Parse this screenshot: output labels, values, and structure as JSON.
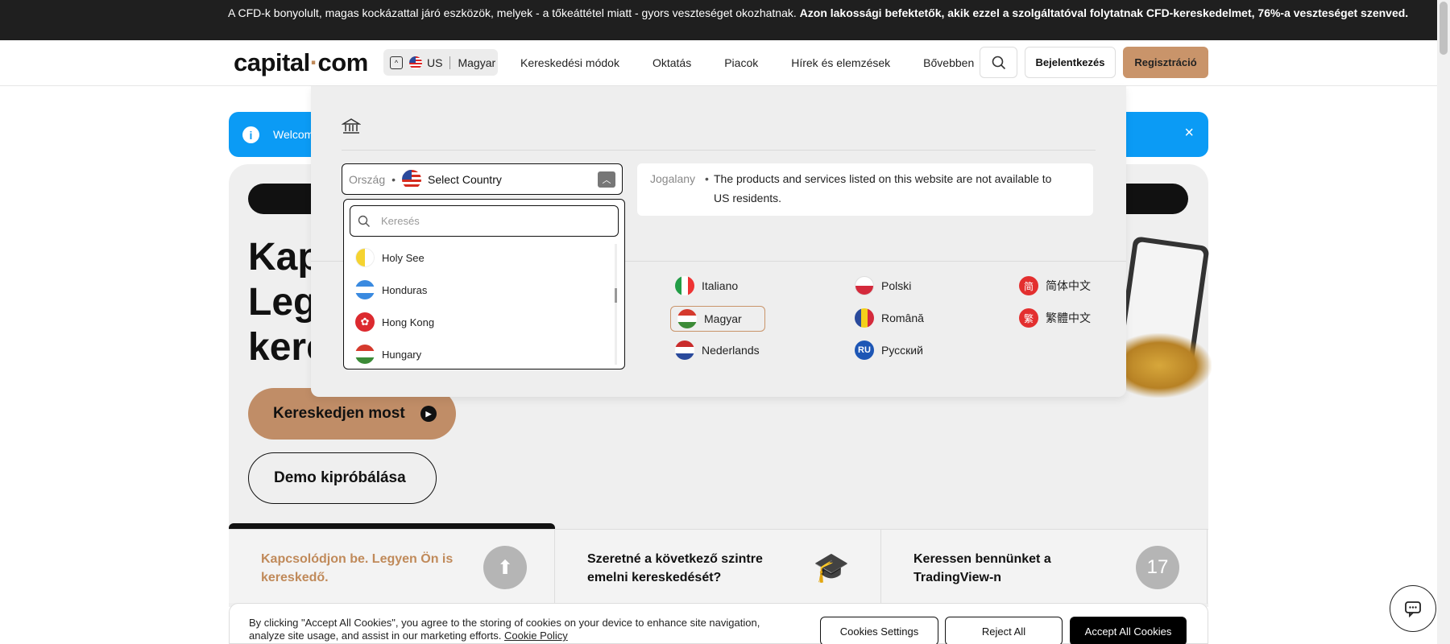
{
  "risk_banner": {
    "text": "A CFD-k bonyolult, magas kockázattal járó eszközök, melyek - a tőkeáttétel miatt - gyors veszteséget okozhatnak. ",
    "bold": "Azon lakossági befektetők, akik ezzel a szolgáltatóval folytatnak CFD-kereskedelmet, 76%-a veszteséget szenved."
  },
  "header": {
    "logo_left": "capital",
    "logo_dot": "·",
    "logo_right": "com",
    "locale_country": "US",
    "locale_language": "Magyar",
    "nav": [
      "Kereskedési módok",
      "Oktatás",
      "Piacok",
      "Hírek és elemzések",
      "Bővebben"
    ],
    "login": "Bejelentkezés",
    "register": "Regisztráció"
  },
  "welcome": {
    "text": "Welcom",
    "close": "×"
  },
  "hero": {
    "title_lines": [
      "Kap",
      "Leg",
      "kere"
    ],
    "cta": "Kereskedjen most",
    "demo": "Demo kipróbálása"
  },
  "cards": [
    {
      "text": "Kapcsolódjon be. Legyen Ön is kereskedő.",
      "icon": "up-arrow-icon"
    },
    {
      "text": "Szeretné a következő szintre emelni kereskedését?",
      "icon": "graduation-cap-icon"
    },
    {
      "text": "Keressen bennünket a TradingView-n",
      "icon": "tradingview-icon"
    }
  ],
  "cookie": {
    "text": "By clicking \"Accept All Cookies\", you agree to the storing of cookies on your device to enhance site navigation, analyze site usage, and assist in our marketing efforts.",
    "policy": "Cookie Policy",
    "settings": "Cookies Settings",
    "reject": "Reject All",
    "accept": "Accept All Cookies"
  },
  "panel": {
    "country_label": "Ország",
    "bullet": "•",
    "country_value": "Select Country",
    "jurisdiction_label": "Jogalany",
    "jurisdiction_text": "The products and services listed on this website are not available to US residents.",
    "languages": [
      {
        "label": "Italiano",
        "flag": "it"
      },
      {
        "label": "Magyar",
        "flag": "hu",
        "selected": true
      },
      {
        "label": "Nederlands",
        "flag": "nl"
      },
      {
        "label": "Polski",
        "flag": "pl"
      },
      {
        "label": "Română",
        "flag": "ro"
      },
      {
        "label": "Русский",
        "flag": "ru",
        "badge": "RU"
      },
      {
        "label": "简体中文",
        "flag": "cn",
        "badge": "简"
      },
      {
        "label": "繁體中文",
        "flag": "cn",
        "badge": "繁"
      }
    ]
  },
  "country_list": {
    "search_placeholder": "Keresés",
    "items": [
      {
        "label": "Holy See",
        "flag": "va"
      },
      {
        "label": "Honduras",
        "flag": "hn"
      },
      {
        "label": "Hong Kong",
        "flag": "hk"
      },
      {
        "label": "Hungary",
        "flag": "hu"
      }
    ]
  }
}
